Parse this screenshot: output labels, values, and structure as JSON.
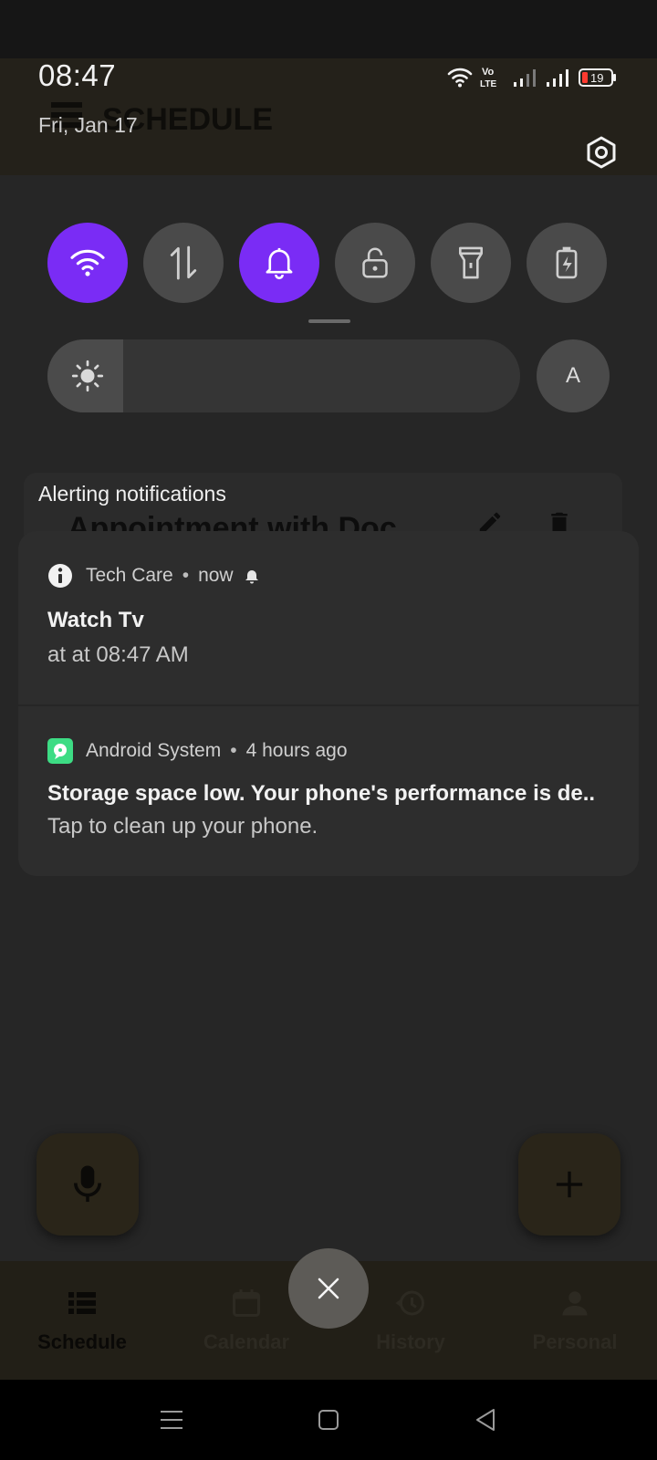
{
  "background_app": {
    "header_title": "SCHEDULE",
    "card_title": "Appointment with Doc",
    "nav": [
      {
        "label": "Schedule",
        "icon": "list-icon"
      },
      {
        "label": "Calendar",
        "icon": "calendar-icon"
      },
      {
        "label": "History",
        "icon": "history-icon"
      },
      {
        "label": "Personal",
        "icon": "person-icon"
      }
    ]
  },
  "status_bar": {
    "time": "08:47",
    "date": "Fri, Jan 17",
    "volte_label_top": "Vo",
    "volte_label_bottom": "LTE",
    "battery_level": "19",
    "icons": [
      "wifi-icon",
      "volte-icon",
      "signal-icon",
      "signal-icon",
      "battery-icon"
    ]
  },
  "quick_settings": {
    "tiles": [
      {
        "name": "wifi",
        "active": true
      },
      {
        "name": "mobile-data",
        "active": false
      },
      {
        "name": "sound",
        "active": true
      },
      {
        "name": "rotation-lock",
        "active": false
      },
      {
        "name": "flashlight",
        "active": false
      },
      {
        "name": "battery-saver",
        "active": false
      }
    ],
    "brightness_level": 0.16,
    "auto_label": "A"
  },
  "notifications": {
    "section_title": "Alerting notifications",
    "items": [
      {
        "app": "Tech Care",
        "time": "now",
        "title": "Watch Tv",
        "text": "at  at 08:47 AM"
      },
      {
        "app": "Android System",
        "time": "4 hours ago",
        "title": "Storage space low. Your phone's performance is de..",
        "text": "Tap to clean up your phone."
      }
    ],
    "separator": "•"
  },
  "colors": {
    "accent": "#7a2cf5",
    "tile_inactive": "#4a4a4a",
    "panel": "#2d2d2d",
    "android_system_icon": "#3ddc84"
  }
}
